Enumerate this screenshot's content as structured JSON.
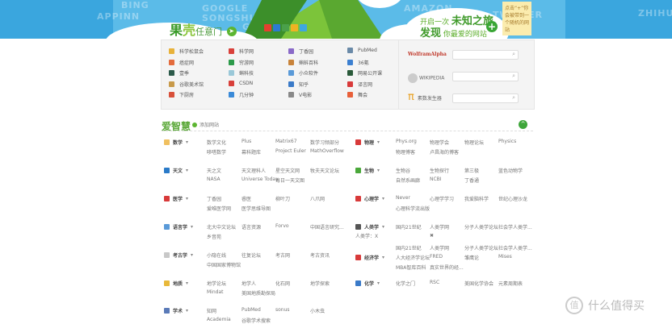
{
  "banner": {
    "logo_main": "果",
    "logo_ke": "壳",
    "logo_sub": "任意门",
    "bg_words": [
      "BING",
      "APPINN",
      "GOOGLE",
      "SONGSHUHUI",
      "GUOKR",
      "AMAZON",
      "TWITTER",
      "DOUBAN",
      "DISCOVER",
      "ZHIHU"
    ],
    "slogan_line1_small": "开启一次",
    "slogan_line1_big": "未知之旅",
    "slogan_line2_big": "发现",
    "slogan_line2_small": "你最爱的网站",
    "plus_label": "+",
    "note_text": "点击“+”你会被带到一个随机的网站",
    "social_colors": [
      "#e5402f",
      "#2c7bd1",
      "#4aa04a",
      "#f0b323",
      "#3fa7e0"
    ]
  },
  "quick_links": [
    {
      "label": "科学松鼠会",
      "color": "#e8b23a"
    },
    {
      "label": "科学网",
      "color": "#d9403a"
    },
    {
      "label": "丁香园",
      "color": "#8a6ac8"
    },
    {
      "label": "PubMed",
      "color": "#6a8aa8"
    },
    {
      "label": "癌症网",
      "color": "#e36b3c"
    },
    {
      "label": "穷游网",
      "color": "#2c9a4a"
    },
    {
      "label": "蝌蚪百科",
      "color": "#c8833a"
    },
    {
      "label": "36氪",
      "color": "#3b7fd0"
    },
    {
      "label": "壹季",
      "color": "#2c5a4a"
    },
    {
      "label": "蝌科技",
      "color": "#9ac8d8"
    },
    {
      "label": "小众软件",
      "color": "#5a9ad8"
    },
    {
      "label": "网易公开课",
      "color": "#2a5a3a"
    },
    {
      "label": "谷歌美术馆",
      "color": "#c89a4a"
    },
    {
      "label": "CSDN",
      "color": "#d8403a"
    },
    {
      "label": "知乎",
      "color": "#3a7ac8"
    },
    {
      "label": "译言网",
      "color": "#d83a3a"
    },
    {
      "label": "下厨房",
      "color": "#d8503a"
    },
    {
      "label": "几分钟",
      "color": "#3a8ad8"
    },
    {
      "label": "V电影",
      "color": "#888888"
    },
    {
      "label": "舞会",
      "color": "#e8603a"
    }
  ],
  "search_tools": [
    {
      "label": "WolframAlpha",
      "placeholder": "",
      "icon": "search-icon"
    },
    {
      "label": "WIKIPEDIA",
      "placeholder": "",
      "icon": "search-icon"
    },
    {
      "label": "素数发生器",
      "symbol": "π",
      "placeholder": "",
      "icon": "search-icon"
    }
  ],
  "section": {
    "title": "爱智慧",
    "add_site": "添加网站",
    "collapse_icon": "^"
  },
  "left_categories": [
    {
      "name": "数学",
      "color": "#f0c060",
      "lines": [
        [
          "数学文化",
          "Plus",
          "Matrix67",
          "数学习频部分"
        ],
        [
          "哆嗒数学",
          "幕科题库",
          "Project Euler",
          "MathOverflow"
        ]
      ]
    },
    {
      "name": "天文",
      "color": "#2a7ac8",
      "lines": [
        [
          "天之文",
          "天文理科人",
          "星空天文网",
          "牧夫天文论坛"
        ],
        [
          "NASA",
          "Universe Today",
          "每日一天文图"
        ]
      ]
    },
    {
      "name": "医学",
      "color": "#d83a3a",
      "lines": [
        [
          "丁香园",
          "睿医",
          "柳叶刀",
          "八爪网"
        ],
        [
          "爱唯医学网",
          "医学思维导图"
        ]
      ]
    },
    {
      "name": "语言学",
      "color": "#5a9ad8",
      "lines": [
        [
          "北大中文论坛",
          "语言资源",
          "Forvo",
          "中国语言研究..."
        ],
        [
          "乡音苑"
        ]
      ]
    },
    {
      "name": "考古学",
      "color": "#c8c8c8",
      "lines": [
        [
          "小隐在线",
          "往复论坛",
          "考古网",
          "考古资讯"
        ],
        [
          "中国国家博物馆"
        ]
      ]
    },
    {
      "name": "地质",
      "color": "#e8b83a",
      "lines": [
        [
          "地学论坛",
          "地学人",
          "化石网",
          "地学探索"
        ],
        [
          "Mindat",
          "美国地质勘探局"
        ]
      ]
    },
    {
      "name": "学术",
      "color": "#5a7ab8",
      "lines": [
        [
          "知网",
          "PubMed",
          "sonus",
          "小木虫"
        ],
        [
          "Academia",
          "谷歌学术搜索"
        ]
      ]
    }
  ],
  "right_categories": [
    {
      "name": "物理",
      "color": "#d83a3a",
      "lines": [
        [
          "Phys.org",
          "物理学会",
          "物理论坛",
          "Physics"
        ],
        [
          "物理博客",
          "卢昌海的博客"
        ]
      ]
    },
    {
      "name": "生物",
      "color": "#4aa83a",
      "lines": [
        [
          "生物谷",
          "生物探行",
          "第三极",
          "蓝色动物学"
        ],
        [
          "自然系画廊",
          "NCBI",
          "丁香通"
        ]
      ]
    },
    {
      "name": "心理学",
      "color": "#d83a3a",
      "lines": [
        [
          "Never",
          "心理学学习",
          "我爱脑科学",
          "世纪心理沙龙"
        ],
        [
          "心理科学流出版"
        ]
      ]
    },
    {
      "name": "人类学",
      "color": "#555555",
      "sub": "人类学：X",
      "lines": [
        [
          "国内21世纪",
          "人类学网",
          "分子人类学论坛",
          "社会学人类学..."
        ],
        [
          "",
          "✖"
        ]
      ]
    },
    {
      "name": "经济学",
      "color": "#d83a3a",
      "lines": [
        [
          "国内21世纪",
          "人类学网",
          "分子人类学论坛",
          "社会学人类学..."
        ],
        [
          "人大经济学论坛",
          "FRED",
          "雏鹰论",
          "Mises"
        ],
        [
          "MBA智库百科",
          "真实世界的经..."
        ]
      ]
    },
    {
      "name": "化学",
      "color": "#3a7ac8",
      "lines": [
        [
          "化学之门",
          "RSC",
          "美国化学协会",
          "元素周期表"
        ]
      ]
    }
  ],
  "watermark": {
    "icon": "值",
    "text": "什么值得买"
  }
}
